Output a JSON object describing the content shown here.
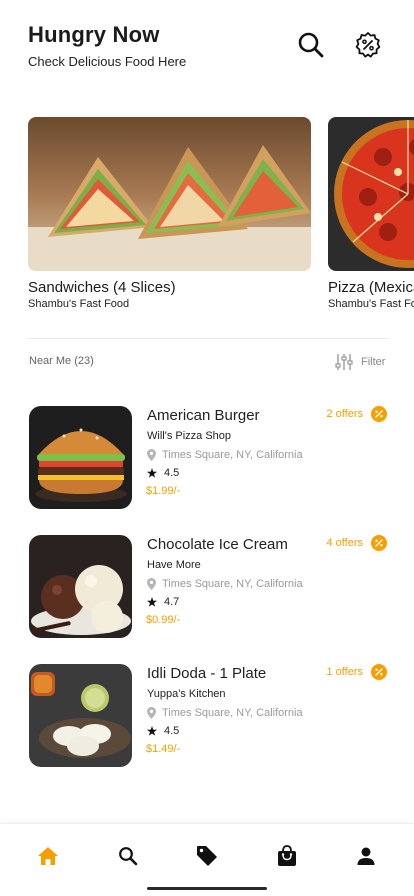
{
  "header": {
    "title": "Hungry Now",
    "subtitle": "Check Delicious Food Here",
    "search_icon": "search-icon",
    "promo_icon": "percent-badge-icon"
  },
  "carousel": [
    {
      "name": "Sandwiches (4 Slices)",
      "shop": "Shambu's Fast Food"
    },
    {
      "name": "Pizza (Mexican)",
      "shop": "Shambu's Fast Food"
    }
  ],
  "filter_bar": {
    "near_label": "Near Me (23)",
    "filter_label": "Filter"
  },
  "items": [
    {
      "name": "American Burger",
      "shop": "Will's Pizza Shop",
      "location": "Times Square, NY, California",
      "rating": "4.5",
      "price": "$1.99/-",
      "offers": "2 offers"
    },
    {
      "name": "Chocolate Ice Cream",
      "shop": "Have More",
      "location": "Times Square, NY, California",
      "rating": "4.7",
      "price": "$0.99/-",
      "offers": "4 offers"
    },
    {
      "name": "Idli Doda - 1 Plate",
      "shop": "Yuppa's Kitchen",
      "location": "Times Square, NY, California",
      "rating": "4.5",
      "price": "$1.49/-",
      "offers": "1 offers"
    }
  ],
  "bottom_nav": [
    "home-icon",
    "search-icon",
    "tag-icon",
    "shopping-bag-icon",
    "profile-icon"
  ],
  "colors": {
    "accent": "#f5a000",
    "text": "#1b1b1b",
    "muted": "#9a9a9a"
  }
}
